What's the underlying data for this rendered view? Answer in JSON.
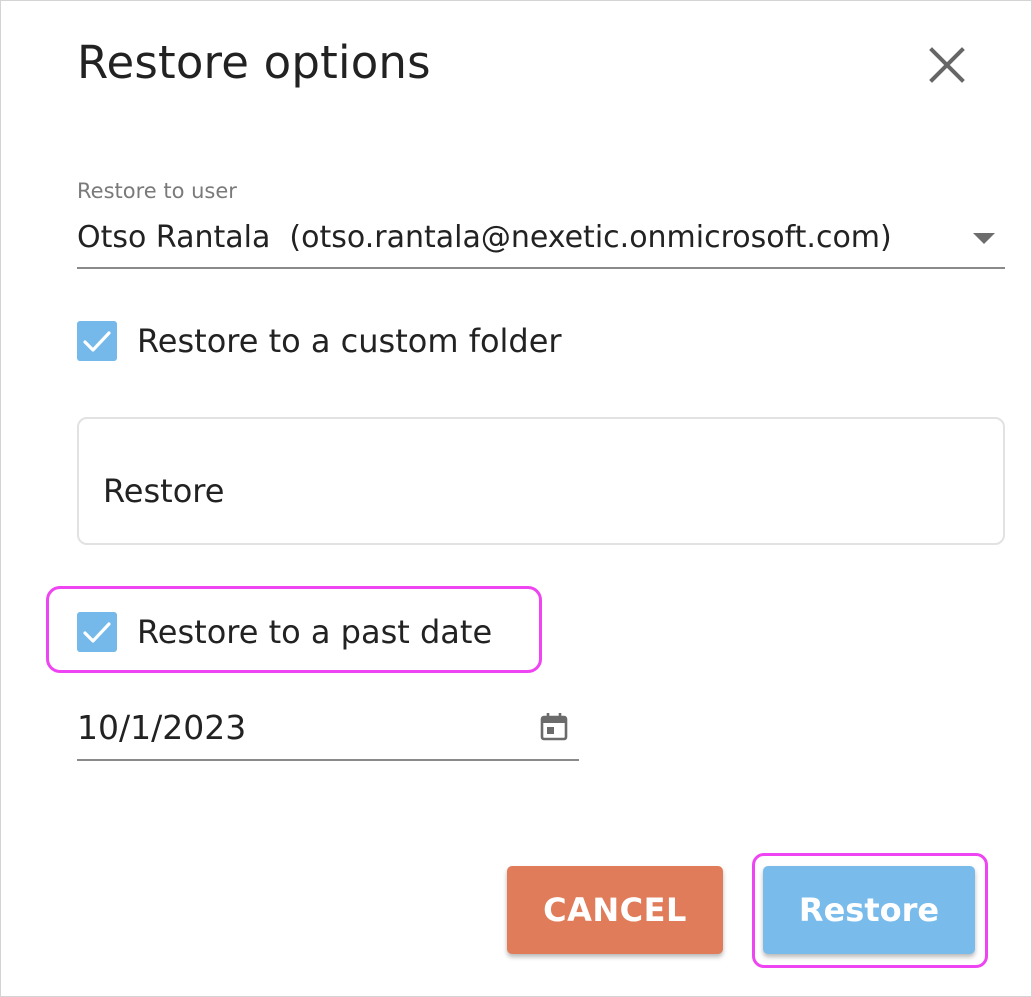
{
  "dialog": {
    "title": "Restore options",
    "close_icon": "close-icon"
  },
  "restore_user": {
    "label": "Restore to user",
    "value": "Otso Rantala  (otso.rantala@nexetic.onmicrosoft.com)",
    "caret_icon": "caret-down-icon"
  },
  "custom_folder": {
    "checked": true,
    "label": "Restore to a custom folder",
    "input_value": "Restore"
  },
  "past_date": {
    "checked": true,
    "label": "Restore to a past date",
    "date_value": "10/1/2023",
    "calendar_icon": "calendar-icon"
  },
  "actions": {
    "cancel_label": "CANCEL",
    "restore_label": "Restore"
  },
  "colors": {
    "checkbox": "#74b9ea",
    "cancel": "#e07c5a",
    "restore": "#79bcec",
    "highlight": "#ee44f1"
  }
}
